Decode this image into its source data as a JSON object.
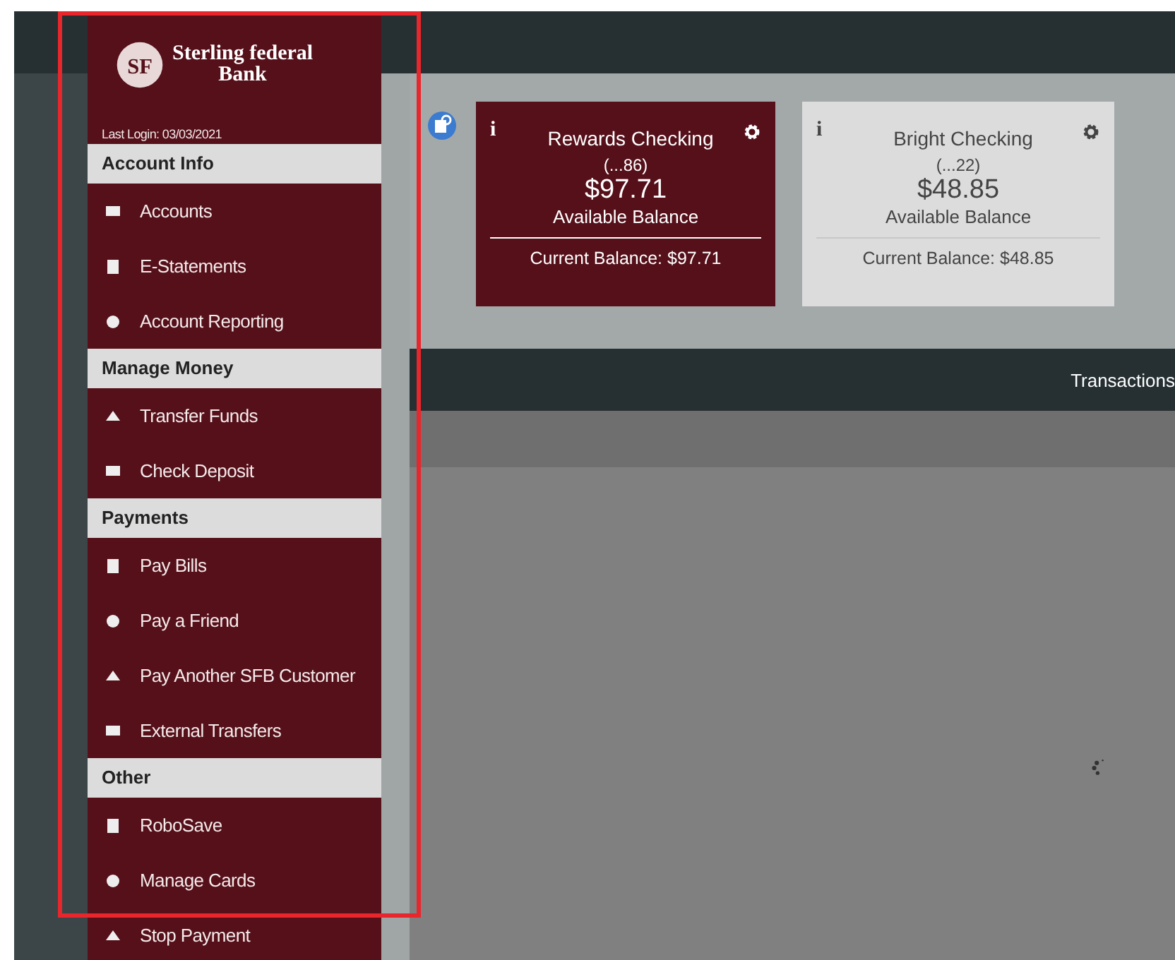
{
  "bank": {
    "name_line_1": "Sterling federal",
    "name_line_2": "Bank",
    "logo_letters": "SF"
  },
  "last_login": "Last Login: 03/03/2021",
  "sidebar": {
    "sections": [
      {
        "title": "Account Info",
        "items": [
          {
            "label": "Accounts"
          },
          {
            "label": "E-Statements"
          },
          {
            "label": "Account Reporting"
          }
        ]
      },
      {
        "title": "Manage Money",
        "items": [
          {
            "label": "Transfer Funds"
          },
          {
            "label": "Check Deposit"
          }
        ]
      },
      {
        "title": "Payments",
        "items": [
          {
            "label": "Pay Bills"
          },
          {
            "label": "Pay a Friend"
          },
          {
            "label": "Pay Another SFB Customer"
          },
          {
            "label": "External Transfers"
          }
        ]
      },
      {
        "title": "Other",
        "items": [
          {
            "label": "RoboSave"
          },
          {
            "label": "Manage Cards"
          },
          {
            "label": "Stop Payment"
          }
        ]
      }
    ]
  },
  "accounts": [
    {
      "name": "Rewards Checking",
      "number": "(...86)",
      "available": "$97.71",
      "available_label": "Available Balance",
      "current": "Current Balance: $97.71",
      "selected": true,
      "info_glyph": "i"
    },
    {
      "name": "Bright Checking",
      "number": "(...22)",
      "available": "$48.85",
      "available_label": "Available Balance",
      "current": "Current Balance: $48.85",
      "selected": false,
      "info_glyph": "i"
    }
  ],
  "transactions_bar": {
    "title": "Transactions"
  }
}
